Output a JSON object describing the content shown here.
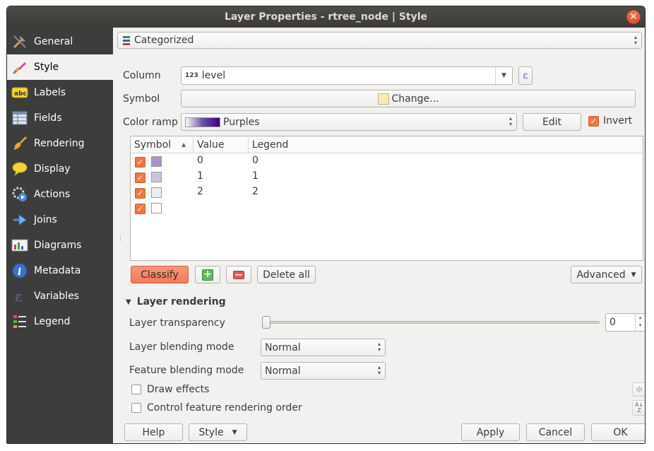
{
  "window": {
    "title": "Layer Properties - rtree_node | Style",
    "close_glyph": "×"
  },
  "sidebar": {
    "items": [
      {
        "label": "General",
        "icon": "tools-icon"
      },
      {
        "label": "Style",
        "icon": "brush-icon"
      },
      {
        "label": "Labels",
        "icon": "abc-icon"
      },
      {
        "label": "Fields",
        "icon": "table-icon"
      },
      {
        "label": "Rendering",
        "icon": "paintbrush-icon"
      },
      {
        "label": "Display",
        "icon": "speech-bubble-icon"
      },
      {
        "label": "Actions",
        "icon": "gear-play-icon"
      },
      {
        "label": "Joins",
        "icon": "join-icon"
      },
      {
        "label": "Diagrams",
        "icon": "diagram-icon"
      },
      {
        "label": "Metadata",
        "icon": "info-icon"
      },
      {
        "label": "Variables",
        "icon": "epsilon-icon"
      },
      {
        "label": "Legend",
        "icon": "legend-icon"
      }
    ],
    "active_index": 1
  },
  "renderer": {
    "selected": "Categorized"
  },
  "column": {
    "label": "Column",
    "type_badge": "123",
    "value": "level",
    "expr_glyph": "ε"
  },
  "symbol": {
    "label": "Symbol",
    "button": "Change..."
  },
  "color_ramp": {
    "label": "Color ramp",
    "value": "Purples",
    "edit_button": "Edit",
    "invert_label": "Invert",
    "invert_checked": true
  },
  "table": {
    "headers": {
      "symbol": "Symbol",
      "value": "Value",
      "legend": "Legend"
    },
    "sort_glyph": "▲",
    "check_glyph": "✓",
    "rows": [
      {
        "value": "0",
        "legend": "0",
        "color": "#a995c9"
      },
      {
        "value": "1",
        "legend": "1",
        "color": "#c9c5e1"
      },
      {
        "value": "2",
        "legend": "2",
        "color": "#ececf4"
      },
      {
        "value": "",
        "legend": "",
        "color": "#ffffff"
      }
    ]
  },
  "actions": {
    "classify": "Classify",
    "add_glyph": "+",
    "remove_glyph": "−",
    "delete_all": "Delete all",
    "advanced": "Advanced"
  },
  "layer_rendering": {
    "header": "Layer rendering",
    "transparency_label": "Layer transparency",
    "transparency_value": "0",
    "blending_label": "Layer blending mode",
    "blending_value": "Normal",
    "feature_blending_label": "Feature blending mode",
    "feature_blending_value": "Normal",
    "draw_effects": "Draw effects",
    "control_order": "Control feature rendering order"
  },
  "footer": {
    "help": "Help",
    "style": "Style",
    "apply": "Apply",
    "cancel": "Cancel",
    "ok": "OK"
  },
  "colors": {
    "accent": "#f07746",
    "sidebar_bg": "#3d3d3d",
    "classify_bg": "#f58865"
  }
}
